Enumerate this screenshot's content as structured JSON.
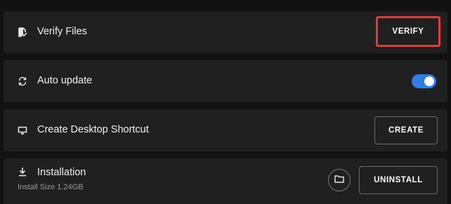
{
  "settings": {
    "verify": {
      "label": "Verify Files",
      "button_label": "VERIFY",
      "icon": "file-check-icon"
    },
    "auto_update": {
      "label": "Auto update",
      "enabled": true,
      "icon": "sync-icon"
    },
    "shortcut": {
      "label": "Create Desktop Shortcut",
      "button_label": "CREATE",
      "icon": "monitor-icon"
    },
    "installation": {
      "label": "Installation",
      "size_text": "Install Size 1.24GB",
      "button_label": "UNINSTALL",
      "icon": "download-icon",
      "folder_icon": "folder-icon"
    }
  },
  "colors": {
    "background": "#121212",
    "row": "#202020",
    "toggle_on": "#2f7ee6",
    "highlight": "#e03b37"
  }
}
